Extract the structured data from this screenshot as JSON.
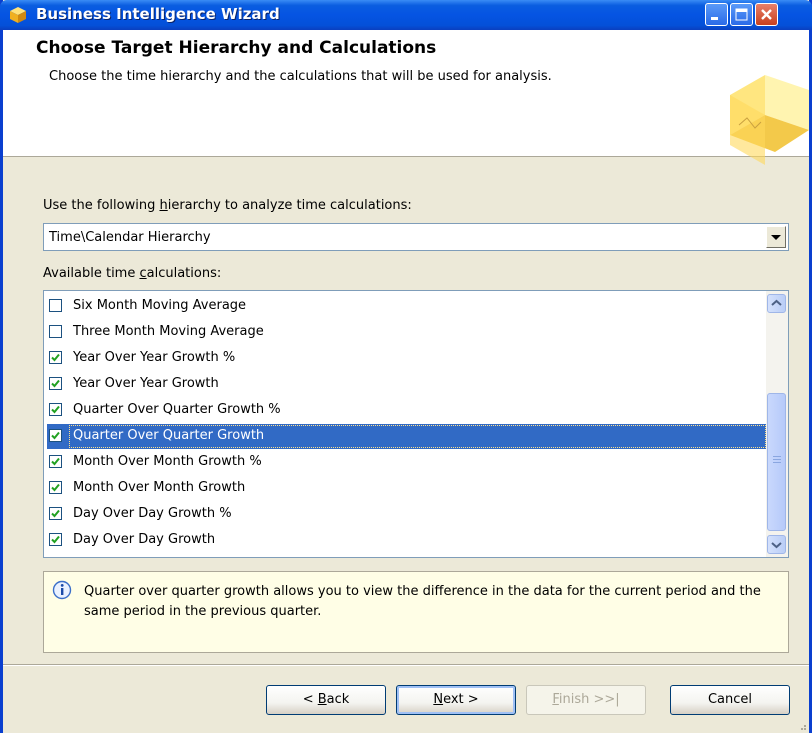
{
  "window": {
    "title": "Business Intelligence Wizard"
  },
  "header": {
    "title": "Choose Target Hierarchy and Calculations",
    "subtitle": "Choose the time hierarchy and the calculations that will be used for analysis."
  },
  "hierarchy": {
    "label_pre": "Use the following ",
    "label_key": "h",
    "label_post": "ierarchy to analyze time calculations:",
    "value": "Time\\Calendar Hierarchy"
  },
  "calculations": {
    "label_pre": "Available time ",
    "label_key": "c",
    "label_post": "alculations:",
    "items": [
      {
        "label": "Six Month Moving Average",
        "checked": false,
        "selected": false
      },
      {
        "label": "Three Month Moving Average",
        "checked": false,
        "selected": false
      },
      {
        "label": "Year Over Year Growth %",
        "checked": true,
        "selected": false
      },
      {
        "label": "Year Over Year Growth",
        "checked": true,
        "selected": false
      },
      {
        "label": "Quarter Over Quarter Growth %",
        "checked": true,
        "selected": false
      },
      {
        "label": "Quarter Over Quarter Growth",
        "checked": true,
        "selected": true
      },
      {
        "label": "Month Over Month Growth %",
        "checked": true,
        "selected": false
      },
      {
        "label": "Month Over Month Growth",
        "checked": true,
        "selected": false
      },
      {
        "label": "Day Over Day Growth %",
        "checked": true,
        "selected": false
      },
      {
        "label": "Day Over Day Growth",
        "checked": true,
        "selected": false
      }
    ]
  },
  "info": {
    "text": "Quarter over quarter growth allows you to view the difference in the data for the current period and the same period in the previous quarter."
  },
  "buttons": {
    "back_pre": "< ",
    "back_key": "B",
    "back_post": "ack",
    "next_key": "N",
    "next_post": "ext >",
    "finish_key": "F",
    "finish_post": "inish >>|",
    "cancel": "Cancel"
  },
  "colors": {
    "selection": "#316ac5",
    "titlebar": "#0554e3",
    "info_background": "#fffee6"
  }
}
